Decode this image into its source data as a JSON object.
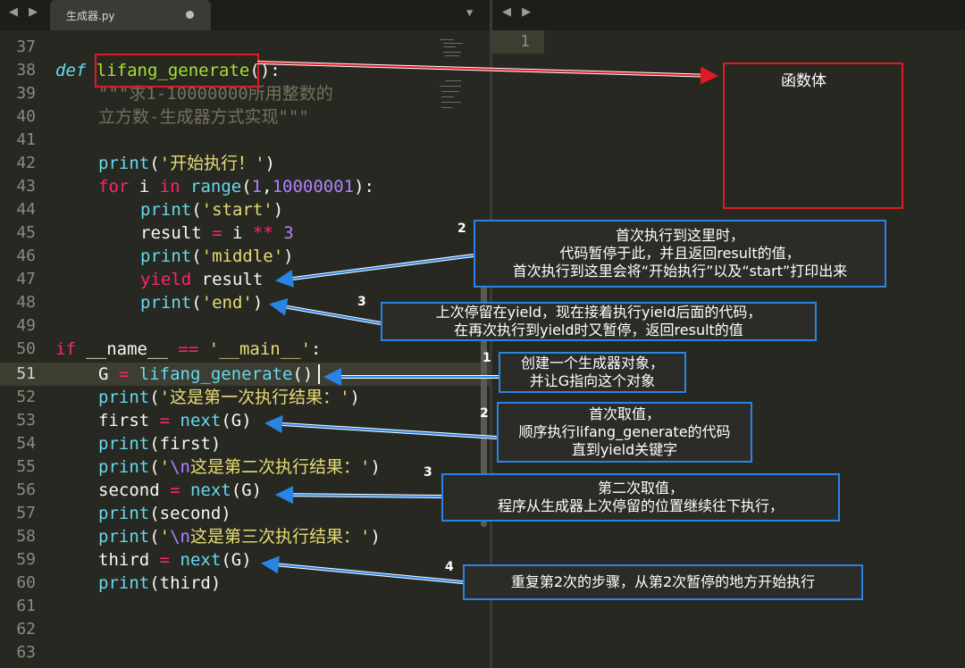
{
  "tab": {
    "filename": "生成器.py",
    "nav_arrows": "◀ ▶",
    "dropdown": "▼"
  },
  "right_pane": {
    "nav_arrows": "◀ ▶",
    "line_number": "1"
  },
  "gutter": {
    "lines": [
      "37",
      "38",
      "39",
      "40",
      "41",
      "42",
      "43",
      "44",
      "45",
      "46",
      "47",
      "48",
      "49",
      "50",
      "51",
      "52",
      "53",
      "54",
      "55",
      "56",
      "57",
      "58",
      "59",
      "60",
      "61",
      "62",
      "63"
    ]
  },
  "code": {
    "l38_def": "def",
    "l38_name": "lifang_generate",
    "l38_rest": "():",
    "l39": "\"\"\"求1-10000000所用整数的",
    "l40": "立方数-生成器方式实现\"\"\"",
    "l42_print": "print",
    "l42_str": "'开始执行！'",
    "l43_for": "for",
    "l43_i": " i ",
    "l43_in": "in",
    "l43_range": "range",
    "l43_1": "1",
    "l43_n": "10000001",
    "l44_str": "'start'",
    "l45_result": "result",
    "l45_i": " i ",
    "l45_pow": "**",
    "l45_3": "3",
    "l46_str": "'middle'",
    "l47_yield": "yield",
    "l47_result": " result",
    "l48_str": "'end'",
    "l50_if": "if",
    "l50_name": " __name__ ",
    "l50_eq": "==",
    "l50_main": "'__main__'",
    "l51_g": "G ",
    "l51_call": "lifang_generate",
    "l52_str": "'这是第一次执行结果：'",
    "l53_first": "first ",
    "l53_next": "next",
    "l54_first": "first",
    "l55_esc": "\\n",
    "l55_str": "这是第二次执行结果：'",
    "l56_second": "second ",
    "l57_second": "second",
    "l58_str": "这是第三次执行结果：'",
    "l59_third": "third ",
    "l60_third": "third"
  },
  "annotations": {
    "function_body_label": "函数体",
    "markers": [
      "2",
      "3",
      "1",
      "2",
      "3",
      "4"
    ],
    "note_yield_first": "首次执行到这里时，\n代码暂停于此，并且返回result的值，\n首次执行到这里会将“开始执行”以及“start”打印出来",
    "note_resume": "上次停留在yield，现在接着执行yield后面的代码，\n在再次执行到yield时又暂停，返回result的值",
    "note_create": "创建一个生成器对象，\n并让G指向这个对象",
    "note_first_next": "首次取值，\n顺序执行lifang_generate的代码\n直到yield关键字",
    "note_second_next": "第二次取值，\n程序从生成器上次停留的位置继续往下执行，",
    "note_third_next": "重复第2次的步骤，从第2次暂停的地方开始执行"
  },
  "colors": {
    "background": "#272822",
    "keyword": "#f92672",
    "function": "#a6e22e",
    "builtin": "#66d9ef",
    "string": "#e6db74",
    "number": "#ae81ff",
    "annotation_red": "#e01b24",
    "annotation_blue": "#2a84e3"
  }
}
